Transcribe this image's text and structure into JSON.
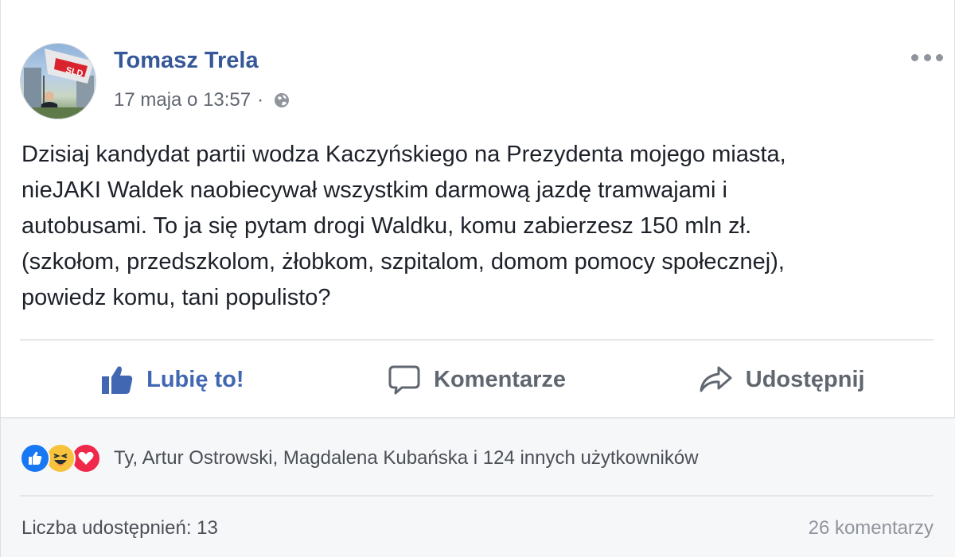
{
  "post": {
    "author": "Tomasz Trela",
    "timestamp": "17 maja o 13:57",
    "separator": "·",
    "privacy_icon": "globe-icon",
    "more_icon": "ellipsis-icon",
    "avatar_banner_text": "SLD",
    "text_lines": [
      "Dzisiaj kandydat partii wodza Kaczyńskiego na Prezydenta mojego miasta,",
      "nieJAKI Waldek naobiecywał wszystkim darmową jazdę tramwajami i",
      "autobusami. To ja się pytam drogi Waldku, komu zabierzesz 150 mln zł.",
      "(szkołom, przedszkolom, żłobkom, szpitalom, domom pomocy społecznej),",
      "powiedz komu, tani populisto?"
    ]
  },
  "actions": {
    "like_label": "Lubię to!",
    "comment_label": "Komentarze",
    "share_label": "Udostępnij"
  },
  "footer": {
    "reaction_types": [
      "like",
      "haha",
      "love"
    ],
    "reactions_text": "Ty, Artur Ostrowski, Magdalena Kubańska i 124 innych użytkowników",
    "shares_text": "Liczba udostępnień: 13",
    "comments_text": "26 komentarzy"
  },
  "colors": {
    "link_blue": "#365899",
    "like_blue": "#4267b2",
    "text_dark": "#1d2129",
    "meta_gray": "#616770",
    "footer_bg": "#f6f7f9"
  }
}
